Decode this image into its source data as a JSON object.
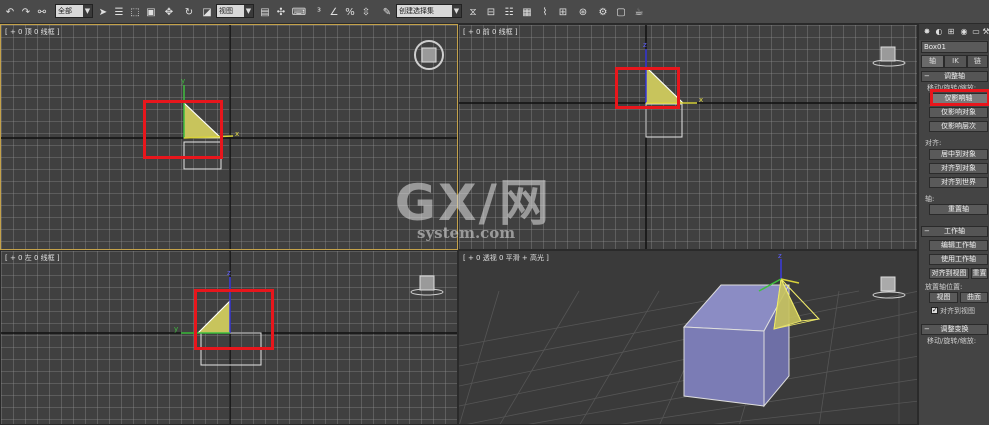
{
  "toolbar": {
    "selection_filter": "全部",
    "reference_coord": "视图",
    "named_selection": "创建选择集",
    "arrow": "▼"
  },
  "viewports": {
    "top": {
      "label": "[ + 0 顶 0 线框 ]"
    },
    "front": {
      "label": "[ + 0 前 0 线框 ]"
    },
    "left": {
      "label": "[ + 0 左 0 线框 ]"
    },
    "perspective": {
      "label": "[ + 0 透视 0 平滑 + 高光 ]"
    }
  },
  "axis_labels": {
    "x": "x",
    "y": "y",
    "z": "z"
  },
  "panel": {
    "object_name": "Box01",
    "subtabs": [
      "轴",
      "IK",
      "链"
    ],
    "rollout_adjust_pivot": "调整轴",
    "move_rotate_scale": "移动/旋转/缩放:",
    "affect_pivot_only": "仅影响轴",
    "affect_object_only": "仅影响对象",
    "affect_hierarchy_only": "仅影响层次",
    "alignment": "对齐:",
    "center_to_object": "居中到对象",
    "align_to_object": "对齐到对象",
    "align_to_world": "对齐到世界",
    "pivot": "轴:",
    "reset_pivot": "重置轴",
    "rollout_working_pivot": "工作轴",
    "edit_working_pivot": "编辑工作轴",
    "use_working_pivot": "使用工作轴",
    "align_to_view": "对齐到视图",
    "reset": "重置",
    "place_pivot_to": "放置轴位置:",
    "view": "视图",
    "surface": "曲面",
    "align_to_view_check": "对齐到视图",
    "check_mark": "✓",
    "rollout_adjust_transform": "调整变换",
    "move_rotate_scale_2": "移动/旋转/缩放:",
    "minus": "−"
  },
  "watermark": {
    "main": "GX/网",
    "sub": "system.com"
  },
  "colors": {
    "highlight": "#e8161c",
    "box": "#7b7cb5",
    "pyramid": "#e2e07a",
    "grid": "#8c8c8c"
  }
}
